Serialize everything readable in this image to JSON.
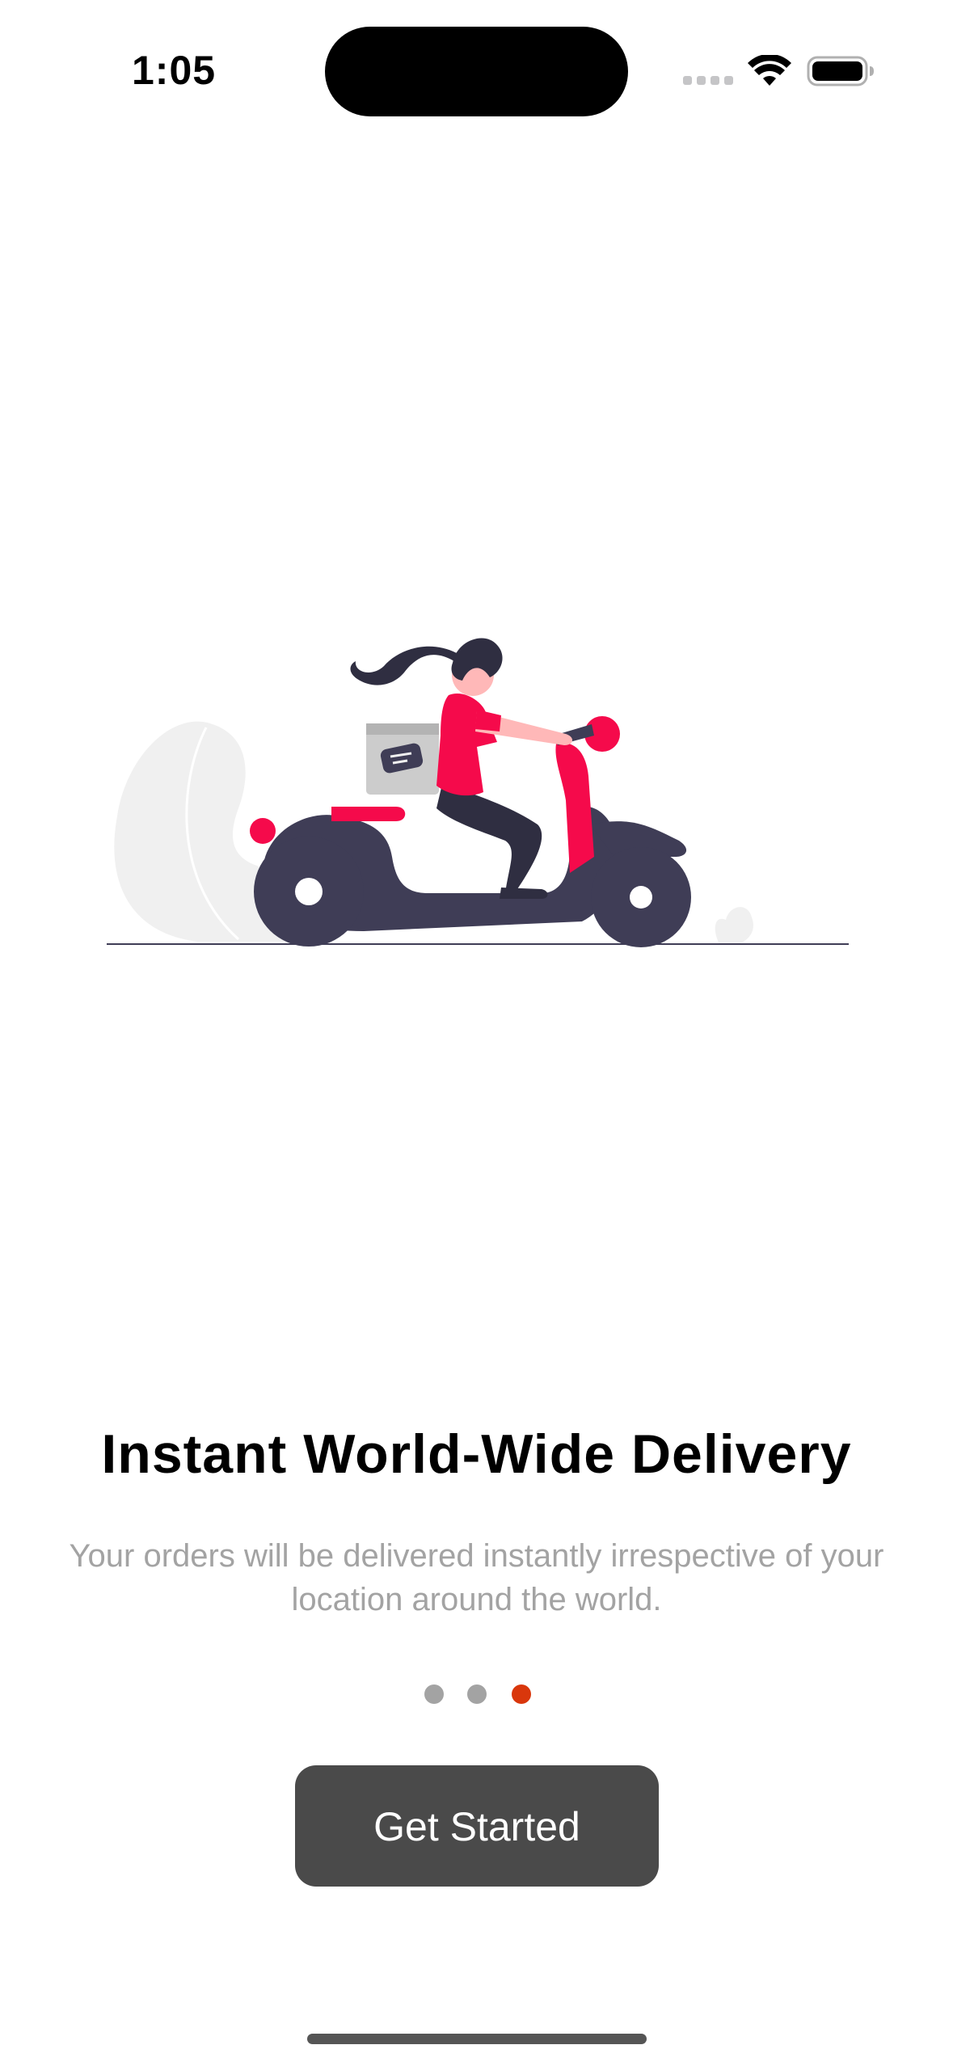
{
  "status_bar": {
    "time": "1:05",
    "icons": [
      "cellular-signal-icon",
      "wifi-icon",
      "battery-icon"
    ]
  },
  "illustration": {
    "subject": "delivery-scooter-illustration",
    "colors": {
      "accent": "#f50a4b",
      "dark": "#3f3d56",
      "skin": "#ffb8b8",
      "foliage": "#f0f0f0",
      "box": "#cccccc"
    }
  },
  "onboarding": {
    "title": "Instant World-Wide Delivery",
    "subtitle": "Your orders will be delivered instantly irrespective of your location around the world.",
    "page_count": 3,
    "active_page": 3,
    "dot_colors": {
      "inactive": "#a3a3a3",
      "active": "#d9370c"
    },
    "button_label": "Get Started",
    "button_color": "#4a4a4a"
  }
}
